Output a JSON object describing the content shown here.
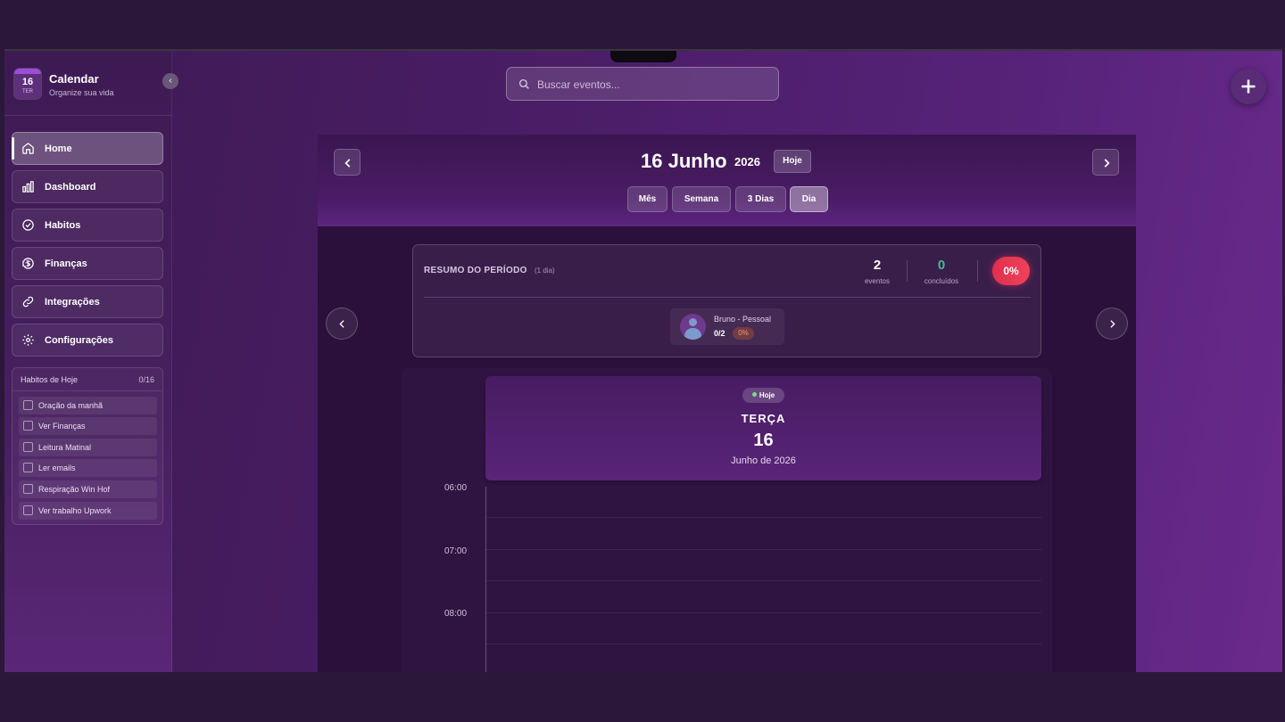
{
  "brand": {
    "day": "16",
    "weekday": "TER",
    "title": "Calendar",
    "subtitle": "Organize sua vida"
  },
  "sidebar": {
    "collapse_icon": "‹",
    "nav": [
      {
        "label": "Home",
        "icon": "home-icon",
        "active": true
      },
      {
        "label": "Dashboard",
        "icon": "bar-chart-icon"
      },
      {
        "label": "Habitos",
        "icon": "check-circle-icon"
      },
      {
        "label": "Finanças",
        "icon": "dollar-icon",
        "external": true
      },
      {
        "label": "Integrações",
        "icon": "link-icon"
      },
      {
        "label": "Configurações",
        "icon": "gear-icon"
      }
    ],
    "habits": {
      "title": "Habitos de Hoje",
      "count": "0/16",
      "items": [
        "Oração da manhã",
        "Ver Finanças",
        "Leitura Matinal",
        "Ler emails",
        "Respiração Win Hof",
        "Ver trabalho Upwork"
      ]
    }
  },
  "search": {
    "placeholder": "Buscar eventos..."
  },
  "header": {
    "date_title": "16 Junho",
    "year": "2026",
    "today": "Hoje",
    "views": [
      {
        "label": "Mês"
      },
      {
        "label": "Semana"
      },
      {
        "label": "3 Dias"
      },
      {
        "label": "Dia",
        "active": true
      }
    ]
  },
  "summary": {
    "title": "RESUMO DO PERÍODO",
    "period": "(1 dia)",
    "events_count": "2",
    "events_label": "eventos",
    "done_count": "0",
    "done_label": "concluídos",
    "percent": "0%",
    "person": {
      "name": "Bruno - Pessoal",
      "count": "0/2",
      "percent": "0%"
    }
  },
  "day": {
    "badge": "Hoje",
    "weekday": "TERÇA",
    "number": "16",
    "month_year": "Junho de 2026",
    "hours": [
      "06:00",
      "07:00",
      "08:00"
    ]
  },
  "colors": {
    "accent": "#9b4fd6",
    "danger": "#e0304e",
    "success": "#3cc08a"
  }
}
